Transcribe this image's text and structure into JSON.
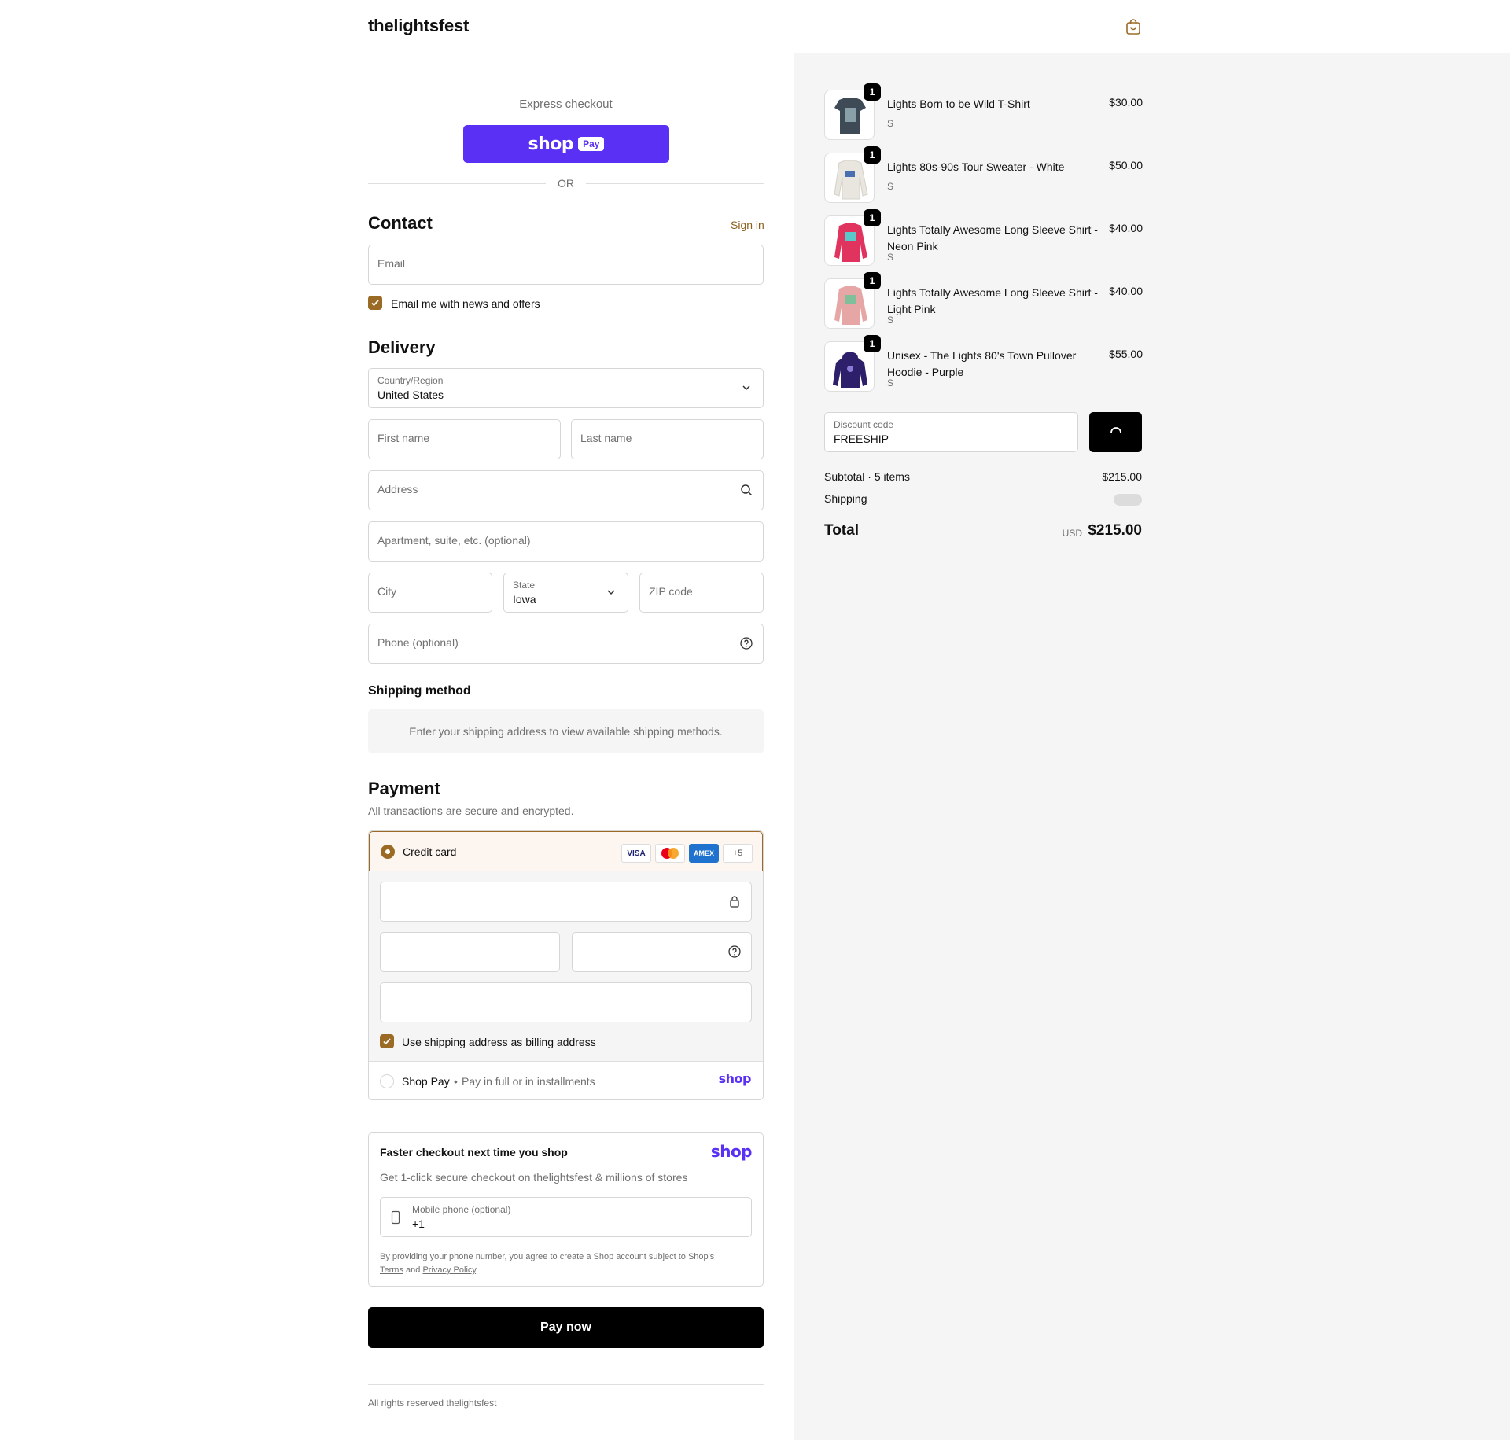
{
  "header": {
    "store_name": "thelightsfest",
    "bag_icon": "shopping-bag-icon"
  },
  "express": {
    "title": "Express checkout",
    "shop_word": "shop",
    "pay_word": "Pay",
    "or_text": "OR"
  },
  "contact": {
    "heading": "Contact",
    "sign_in": "Sign in",
    "email_placeholder": "Email",
    "newsletter_label": "Email me with news and offers",
    "newsletter_checked": true
  },
  "delivery": {
    "heading": "Delivery",
    "country_label": "Country/Region",
    "country_value": "United States",
    "first_name_placeholder": "First name",
    "last_name_placeholder": "Last name",
    "address_placeholder": "Address",
    "apartment_placeholder": "Apartment, suite, etc. (optional)",
    "city_placeholder": "City",
    "state_label": "State",
    "state_value": "Iowa",
    "zip_placeholder": "ZIP code",
    "phone_placeholder": "Phone (optional)"
  },
  "shipping_method": {
    "heading": "Shipping method",
    "note": "Enter your shipping address to view available shipping methods."
  },
  "payment": {
    "heading": "Payment",
    "subtitle": "All transactions are secure and encrypted.",
    "credit_card_label": "Credit card",
    "card_brands": [
      "VISA",
      "",
      "AMEX",
      "+5"
    ],
    "billing_label": "Use shipping address as billing address",
    "billing_checked": true,
    "shop_pay_label": "Shop Pay",
    "shop_pay_desc": "Pay in full or in installments",
    "shop_logo": "shop"
  },
  "faster_checkout": {
    "title": "Faster checkout next time you shop",
    "logo": "shop",
    "desc": "Get 1-click secure checkout on thelightsfest & millions of stores",
    "phone_label": "Mobile phone (optional)",
    "phone_value": "+1",
    "legal_prefix": "By providing your phone number, you agree to create a Shop account subject to Shop's",
    "terms": "Terms",
    "and": "and",
    "privacy": "Privacy Policy",
    "period": "."
  },
  "pay_now": "Pay now",
  "footer": "All rights reserved thelightsfest",
  "cart": {
    "items": [
      {
        "name": "Lights Born to be Wild T-Shirt",
        "variant": "S",
        "price": "$30.00",
        "qty": "1",
        "color": "#3f4a57"
      },
      {
        "name": "Lights 80s-90s Tour Sweater - White",
        "variant": "S",
        "price": "$50.00",
        "qty": "1",
        "color": "#e9e6df"
      },
      {
        "name": "Lights Totally Awesome Long Sleeve Shirt - Neon Pink",
        "variant": "S",
        "price": "$40.00",
        "qty": "1",
        "color": "#e0345f"
      },
      {
        "name": "Lights Totally Awesome Long Sleeve Shirt - Light Pink",
        "variant": "S",
        "price": "$40.00",
        "qty": "1",
        "color": "#e6a6a6"
      },
      {
        "name": "Unisex - The Lights 80's Town Pullover Hoodie - Purple",
        "variant": "S",
        "price": "$55.00",
        "qty": "1",
        "color": "#2e1f6b"
      }
    ],
    "discount_label": "Discount code",
    "discount_value": "FREESHIP",
    "subtotal_label": "Subtotal · 5 items",
    "subtotal_value": "$215.00",
    "shipping_label": "Shipping",
    "total_label": "Total",
    "currency": "USD",
    "total_value": "$215.00"
  },
  "colors": {
    "accent": "#9b6b26",
    "shop_purple": "#5a31f4",
    "panel_bg": "#f5f5f5"
  }
}
